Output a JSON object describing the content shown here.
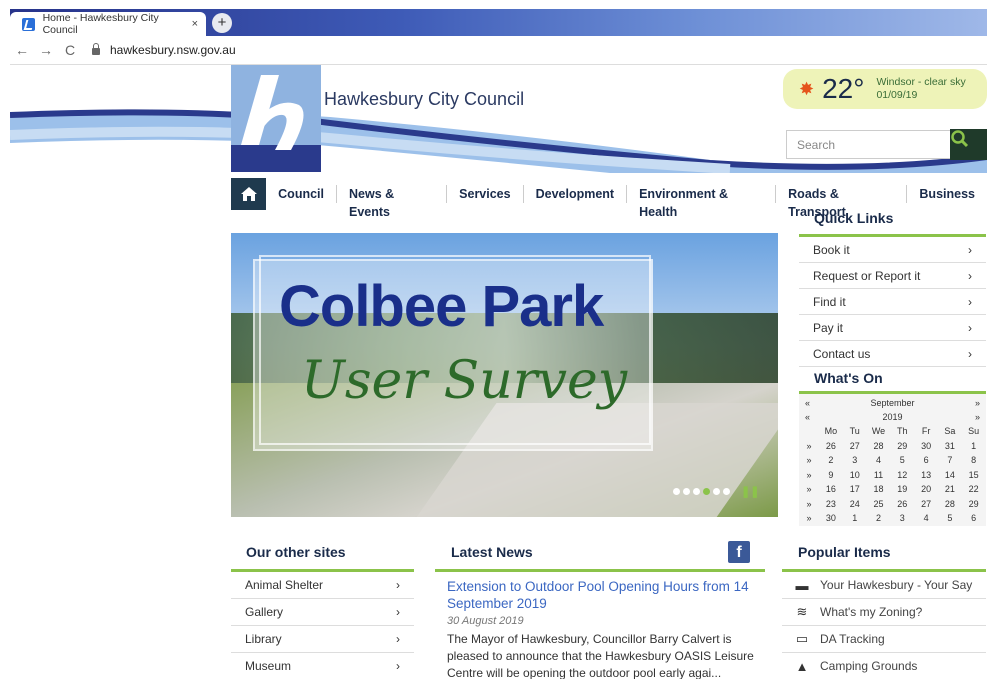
{
  "browser": {
    "tab_title": "Home - Hawkesbury City Council",
    "tab_close": "×",
    "new_tab": "+",
    "back": "←",
    "forward": "→",
    "reload": "C",
    "url": "hawkesbury.nsw.gov.au"
  },
  "header": {
    "council_name": "Hawkesbury City Council",
    "weather": {
      "temperature": "22°",
      "location": "Windsor -  clear sky",
      "date": "01/09/19"
    },
    "search_placeholder": "Search"
  },
  "nav": {
    "items": [
      "Council",
      "News & Events",
      "Services",
      "Development",
      "Environment & Health",
      "Roads & Transport",
      "Business"
    ]
  },
  "hero": {
    "title": "Colbee Park",
    "subtitle": "User Survey",
    "slides": 6,
    "active_slide": 4
  },
  "quick_links": {
    "heading": "Quick Links",
    "items": [
      "Book it",
      "Request or Report it",
      "Find it",
      "Pay it",
      "Contact us"
    ]
  },
  "whats_on": {
    "heading": "What's On",
    "month": "September",
    "year": "2019",
    "prev": "«",
    "next": "»",
    "days": [
      "Mo",
      "Tu",
      "We",
      "Th",
      "Fr",
      "Sa",
      "Su"
    ],
    "weeks": [
      [
        "26",
        "27",
        "28",
        "29",
        "30",
        "31",
        "1"
      ],
      [
        "2",
        "3",
        "4",
        "5",
        "6",
        "7",
        "8"
      ],
      [
        "9",
        "10",
        "11",
        "12",
        "13",
        "14",
        "15"
      ],
      [
        "16",
        "17",
        "18",
        "19",
        "20",
        "21",
        "22"
      ],
      [
        "23",
        "24",
        "25",
        "26",
        "27",
        "28",
        "29"
      ],
      [
        "30",
        "1",
        "2",
        "3",
        "4",
        "5",
        "6"
      ]
    ]
  },
  "other_sites": {
    "heading": "Our other sites",
    "items": [
      "Animal Shelter",
      "Gallery",
      "Library",
      "Museum"
    ]
  },
  "latest_news": {
    "heading": "Latest News",
    "title": "Extension to Outdoor Pool Opening Hours from 14 September 2019",
    "date": "30 August 2019",
    "body": "The Mayor of Hawkesbury, Councillor Barry Calvert is pleased to announce that the Hawkesbury OASIS Leisure Centre will be opening the outdoor pool early agai..."
  },
  "popular": {
    "heading": "Popular Items",
    "items": [
      {
        "label": "Your Hawkesbury - Your Say",
        "icon": "speech-bubble-icon"
      },
      {
        "label": "What's my Zoning?",
        "icon": "layers-icon"
      },
      {
        "label": "DA Tracking",
        "icon": "monitor-icon"
      },
      {
        "label": "Camping Grounds",
        "icon": "tent-icon"
      }
    ]
  },
  "colors": {
    "accent_green": "#8bc34a",
    "navy": "#1a2b4a",
    "link_blue": "#3b67c2"
  }
}
